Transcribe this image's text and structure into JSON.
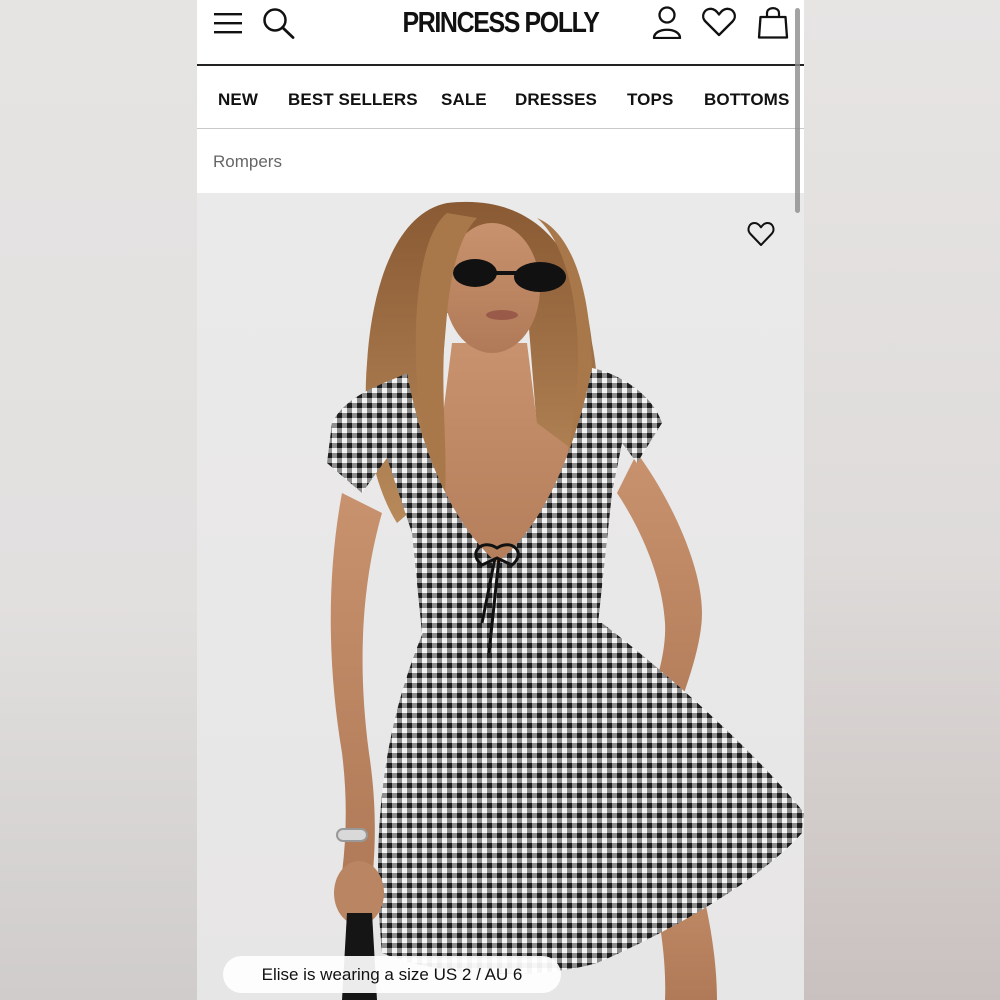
{
  "header": {
    "logo": "PRINCESS POLLY"
  },
  "nav": {
    "items": [
      "NEW",
      "BEST SELLERS",
      "SALE",
      "DRESSES",
      "TOPS",
      "BOTTOMS"
    ]
  },
  "breadcrumb": "Rompers",
  "product_image": {
    "size_note": "Elise is wearing a size US 2 / AU 6"
  },
  "icons": {
    "menu": "menu-icon",
    "search": "search-icon",
    "account": "user-icon",
    "wishlist": "heart-icon",
    "bag": "bag-icon"
  }
}
